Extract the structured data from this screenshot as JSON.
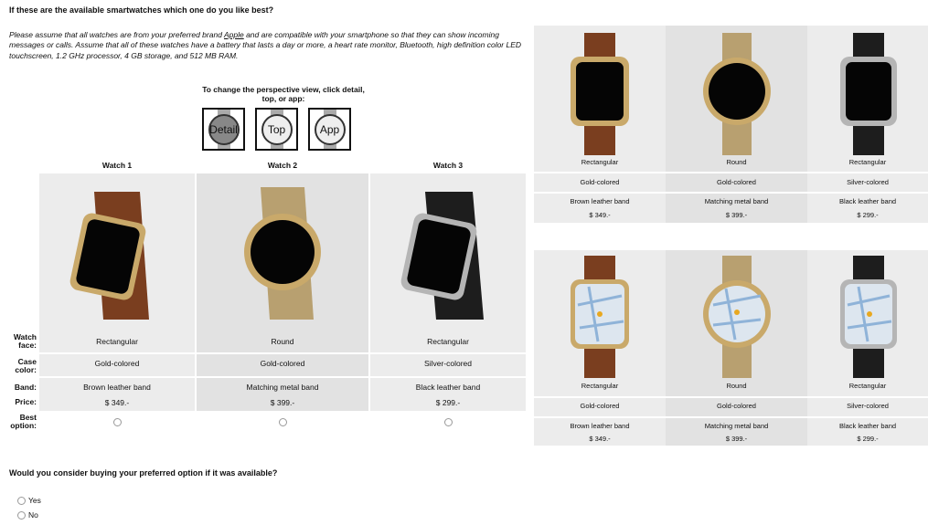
{
  "question": "If these are the available smartwatches which one do you like best?",
  "intro": {
    "before": "Please assume that all watches are from your preferred brand ",
    "brand": "Apple",
    "after": " and are compatible with your smartphone so that they can show incoming messages or calls. Assume that all of these watches have a battery that lasts a day or more, a heart rate monitor, Bluetooth, high definition color LED touchscreen, 1.2 GHz processor, 4 GB storage, and 512 MB RAM."
  },
  "perspective": {
    "text": "To change the perspective view, click detail, top, or app:",
    "buttons": [
      "Detail",
      "Top",
      "App"
    ]
  },
  "watches": [
    {
      "header": "Watch 1",
      "face": "Rectangular",
      "case": "Gold-colored",
      "band": "Brown leather band",
      "price": "$ 349.-",
      "band_color": "#7a3e1f",
      "case_color": "#c9a96a"
    },
    {
      "header": "Watch 2",
      "face": "Round",
      "case": "Gold-colored",
      "band": "Matching metal band",
      "price": "$ 399.-",
      "band_color": "#b8a070",
      "case_color": "#c9a96a"
    },
    {
      "header": "Watch 3",
      "face": "Rectangular",
      "case": "Silver-colored",
      "band": "Black leather band",
      "price": "$ 299.-",
      "band_color": "#1d1d1d",
      "case_color": "#b5b5b5"
    }
  ],
  "row_labels": {
    "face": "Watch face:",
    "case": "Case color:",
    "band": "Band:",
    "price": "Price:",
    "best": "Best option:"
  },
  "follow_up": {
    "question": "Would you consider buying your preferred option if it was available?",
    "options": [
      "Yes",
      "No"
    ]
  }
}
